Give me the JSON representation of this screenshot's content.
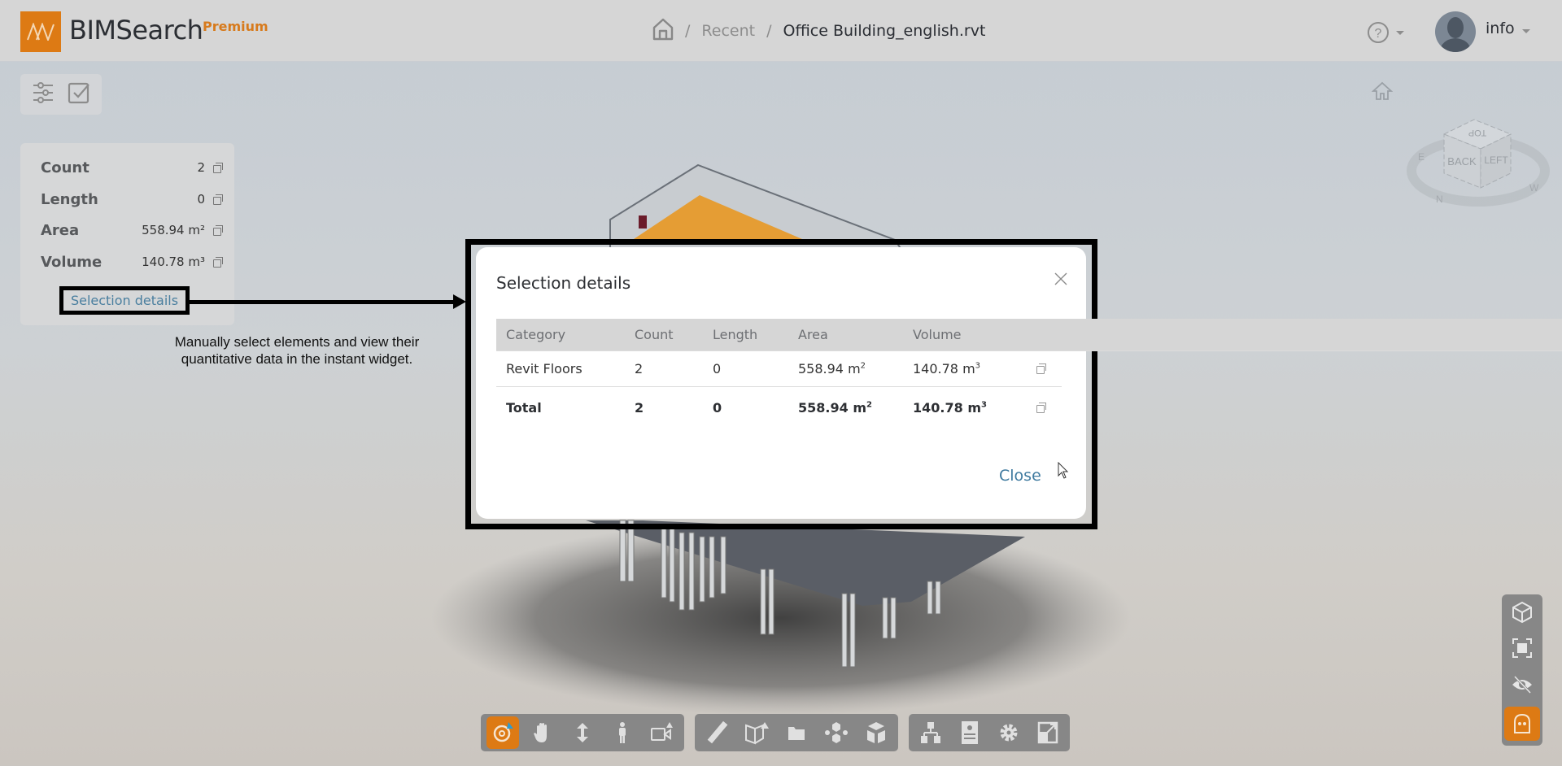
{
  "header": {
    "brand": "BIMSearch",
    "tier": "Premium",
    "breadcrumb": {
      "home_icon": "home-icon",
      "separator": "/",
      "items": [
        "Recent",
        "Office Building_english.rvt"
      ]
    },
    "help_icon": "help-circle-icon",
    "user": {
      "name": "info",
      "avatar_icon": "user-avatar-icon"
    }
  },
  "left_panel": {
    "tools": [
      "filter-sliders-icon",
      "checkbox-icon"
    ],
    "stats": [
      {
        "label": "Count",
        "value": "2"
      },
      {
        "label": "Length",
        "value": "0"
      },
      {
        "label": "Area",
        "value": "558.94 m²"
      },
      {
        "label": "Volume",
        "value": "140.78 m³"
      }
    ],
    "selection_details_link": "Selection details"
  },
  "annotation": {
    "text_line1": "Manually select elements and view their",
    "text_line2": "quantitative data in the instant widget."
  },
  "modal": {
    "title": "Selection details",
    "columns": [
      "Category",
      "Count",
      "Length",
      "Area",
      "Volume"
    ],
    "rows": [
      {
        "category": "Revit Floors",
        "count": "2",
        "length": "0",
        "area": "558.94 m",
        "area_unit_exp": "2",
        "volume": "140.78 m",
        "volume_unit_exp": "3"
      }
    ],
    "total": {
      "category": "Total",
      "count": "2",
      "length": "0",
      "area": "558.94 m",
      "area_unit_exp": "2",
      "volume": "140.78 m",
      "volume_unit_exp": "3"
    },
    "close_label": "Close"
  },
  "viewcube": {
    "faces": [
      "TOP",
      "BACK",
      "LEFT"
    ],
    "compass": [
      "E",
      "N",
      "W"
    ]
  },
  "bottom_toolbar": {
    "groups": [
      [
        "orbit-icon",
        "pan-hand-icon",
        "zoom-updown-icon",
        "walk-person-icon",
        "camera-view-icon"
      ],
      [
        "measure-ruler-icon",
        "section-box-icon",
        "folder-icon",
        "explode-model-icon",
        "model-parts-icon"
      ],
      [
        "hierarchy-tree-icon",
        "properties-panel-icon",
        "settings-gear-icon",
        "fullscreen-icon"
      ]
    ],
    "active": "orbit-icon"
  },
  "right_toolbar": {
    "items": [
      "isometric-cube-icon",
      "fit-to-view-icon",
      "hide-eye-icon",
      "ghost-mode-icon"
    ],
    "active": "ghost-mode-icon"
  },
  "colors": {
    "brand_orange": "#dd7a14",
    "link_blue": "#3f7a9f"
  }
}
